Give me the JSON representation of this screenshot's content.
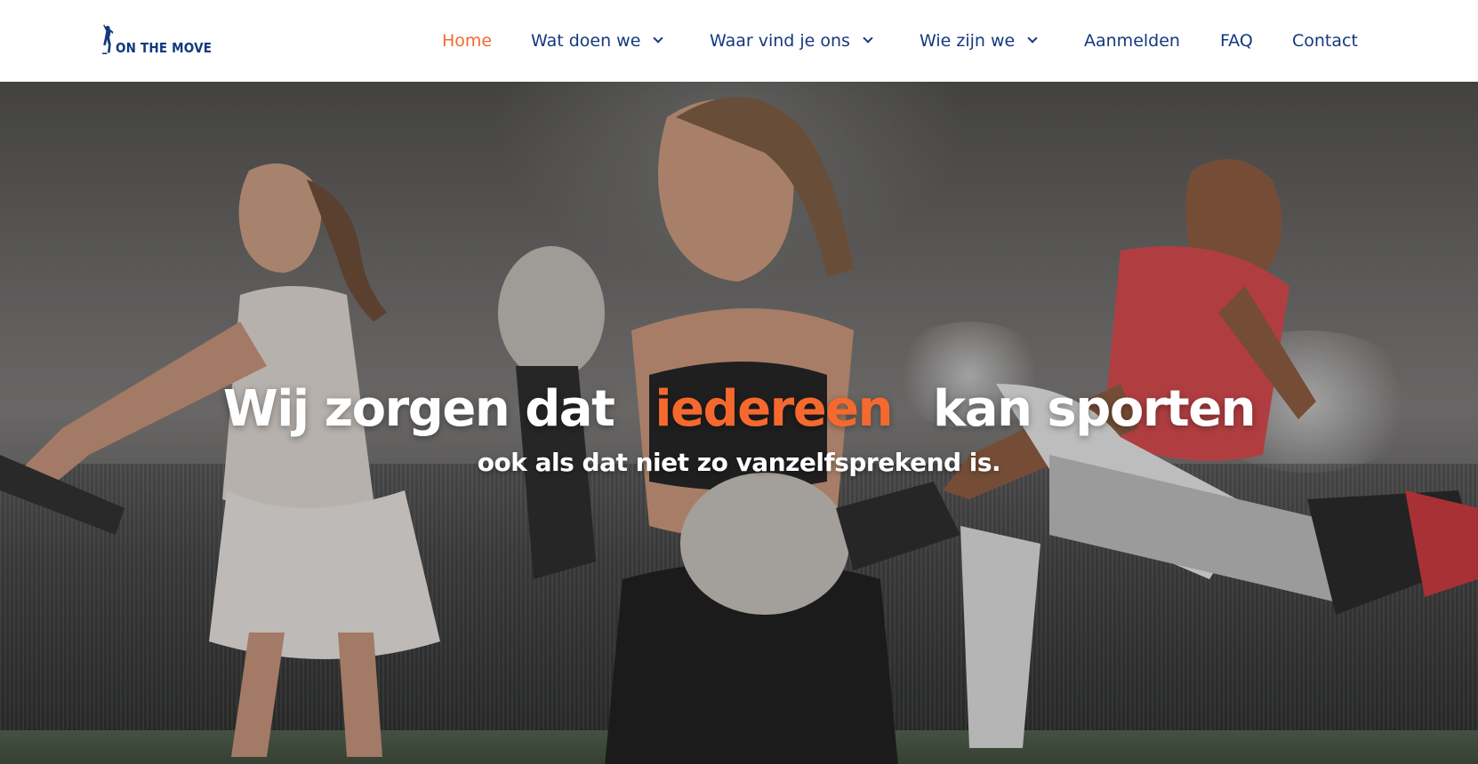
{
  "brand": {
    "logo_text": "ON THE MOVE",
    "color_primary": "#14387f",
    "color_accent": "#f5692f"
  },
  "nav": {
    "items": [
      {
        "label": "Home",
        "active": true,
        "dropdown": false
      },
      {
        "label": "Wat doen we",
        "active": false,
        "dropdown": true
      },
      {
        "label": "Waar vind je ons",
        "active": false,
        "dropdown": true
      },
      {
        "label": "Wie zijn we",
        "active": false,
        "dropdown": true
      },
      {
        "label": "Aanmelden",
        "active": false,
        "dropdown": false
      },
      {
        "label": "FAQ",
        "active": false,
        "dropdown": false
      },
      {
        "label": "Contact",
        "active": false,
        "dropdown": false
      }
    ]
  },
  "hero": {
    "title_before": "Wij zorgen dat",
    "title_highlight": "iedereen",
    "title_after": "kan sporten",
    "subtitle": "ook als dat niet zo vanzelfsprekend is."
  }
}
